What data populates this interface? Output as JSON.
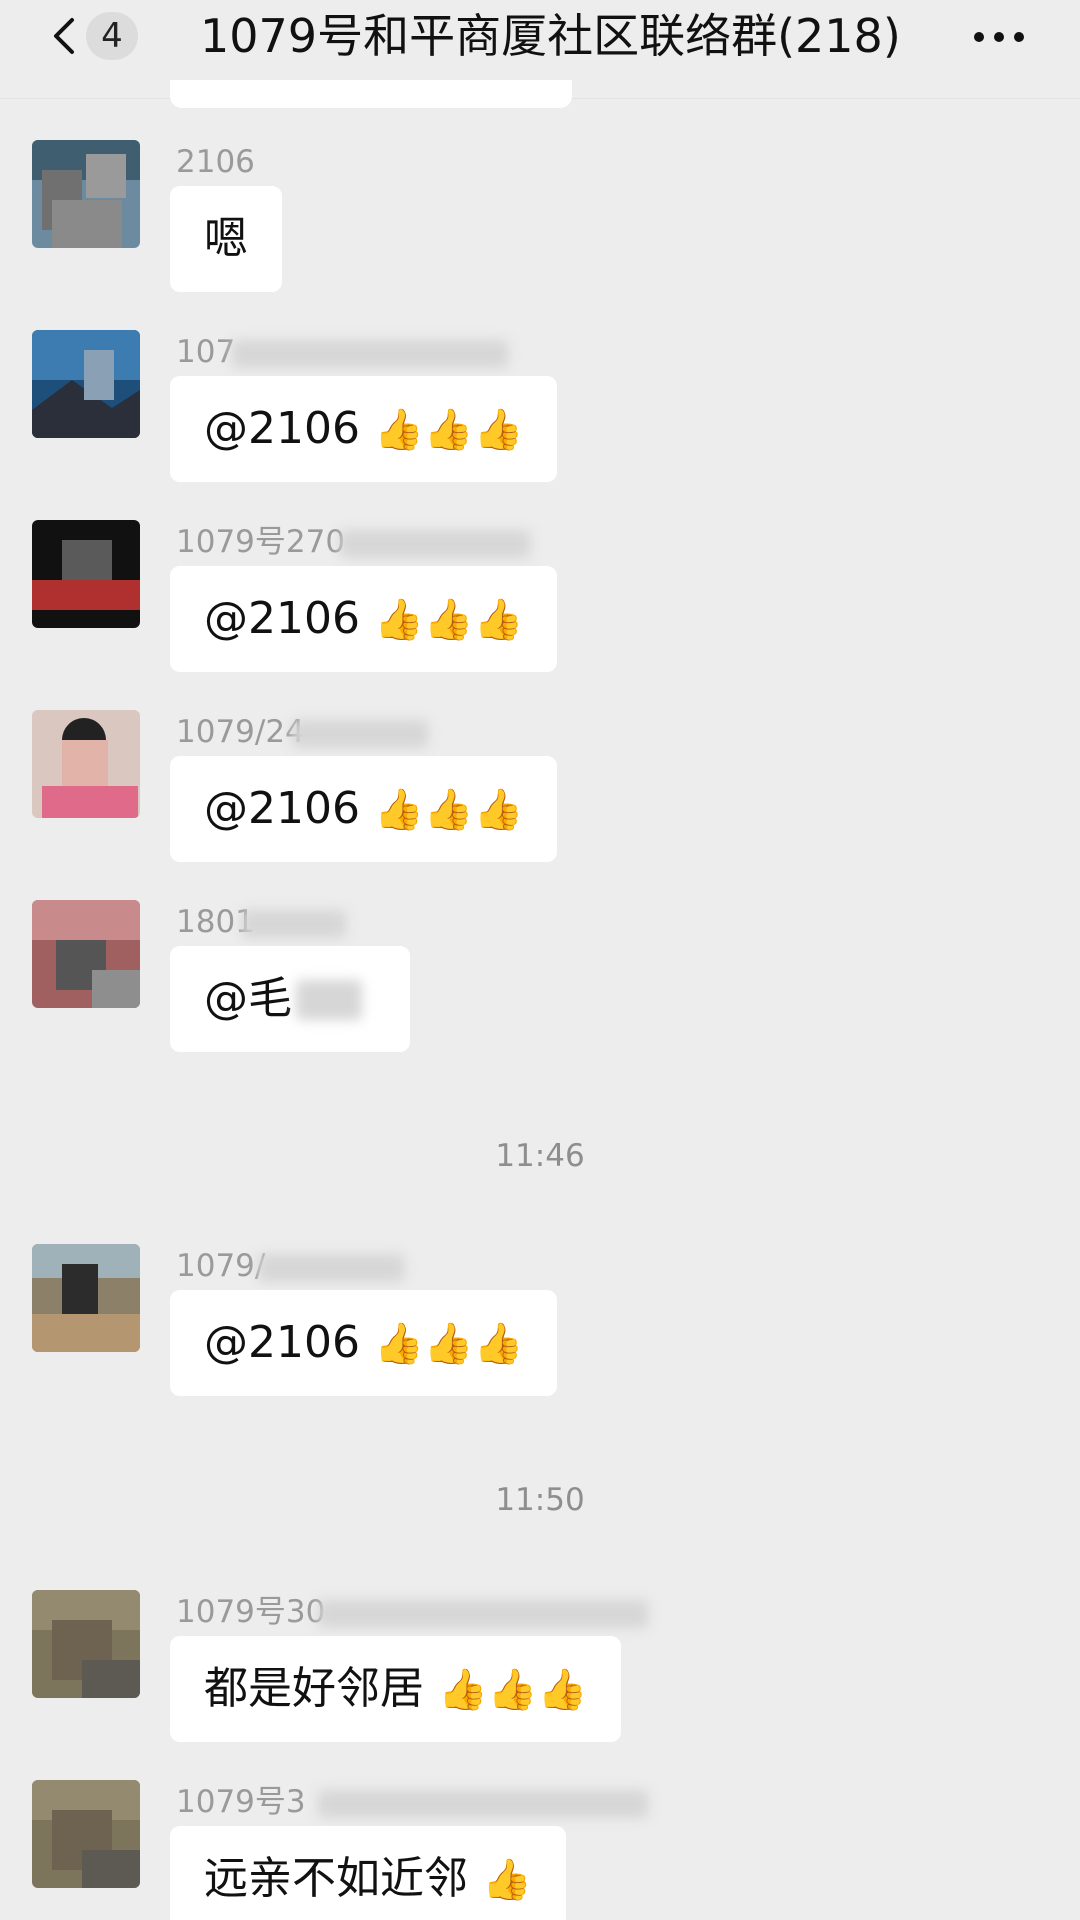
{
  "header": {
    "unread_count": "4",
    "title": "1079号和平商厦社区联络群(218)"
  },
  "messages": [
    {
      "sender": "2106",
      "text": "嗯",
      "emoji": ""
    },
    {
      "sender": "107",
      "text": "@2106",
      "emoji": "👍👍👍"
    },
    {
      "sender": "1079号270",
      "text": "@2106",
      "emoji": "👍👍👍"
    },
    {
      "sender": "1079/24",
      "text": "@2106",
      "emoji": "👍👍👍"
    },
    {
      "sender": "1801",
      "text": "@毛",
      "emoji": ""
    },
    {
      "sender": "1079/",
      "text": "@2106",
      "emoji": "👍👍👍"
    },
    {
      "sender": "1079号30",
      "text": "都是好邻居",
      "emoji": "👍👍👍"
    },
    {
      "sender": "1079号3",
      "text": "远亲不如近邻",
      "emoji": "👍"
    }
  ],
  "timestamps": [
    "11:46",
    "11:50"
  ],
  "colors": {
    "background": "#ededed",
    "bubble": "#ffffff",
    "sender_text": "#9a9a9a"
  },
  "icons": {
    "back": "chevron-left-icon",
    "more": "more-dots-icon",
    "thumbs": "thumbs-up-emoji"
  }
}
